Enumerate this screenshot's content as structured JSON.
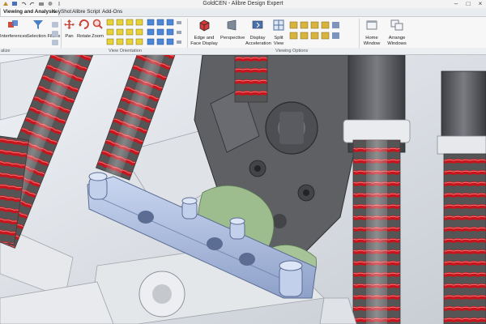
{
  "window": {
    "title": "GoldCEN - Alibre Design Expert"
  },
  "tabs": [
    {
      "label": "Viewing and Analysis",
      "active": true
    },
    {
      "label": "KeyShot",
      "active": false
    },
    {
      "label": "Alibre Script",
      "active": false
    },
    {
      "label": "Add-Ons",
      "active": false
    }
  ],
  "ribbon": {
    "interferences": "Interferences",
    "selection_filters": "Selection Filters",
    "pan": "Pan",
    "rotate": "Rotate",
    "zoom": "Zoom",
    "edge_face_display_1": "Edge and",
    "edge_face_display_2": "Face Display",
    "perspective": "Perspective",
    "display_accel_1": "Display",
    "display_accel_2": "Acceleration",
    "split_view_1": "Split",
    "split_view_2": "View",
    "home": "Home",
    "window": "Window",
    "arrange": "Arrange",
    "windows": "Windows"
  },
  "groups": {
    "left": "alize",
    "view_orientation": "View Orientation",
    "viewing_options": "Viewing Options"
  },
  "colors": {
    "ribbon_bg": "#f7f7f7",
    "spring_red": "#c8141c",
    "part_blue": "#a9bbe0",
    "part_gray": "#5f6064",
    "part_green": "#9dbd8f"
  }
}
